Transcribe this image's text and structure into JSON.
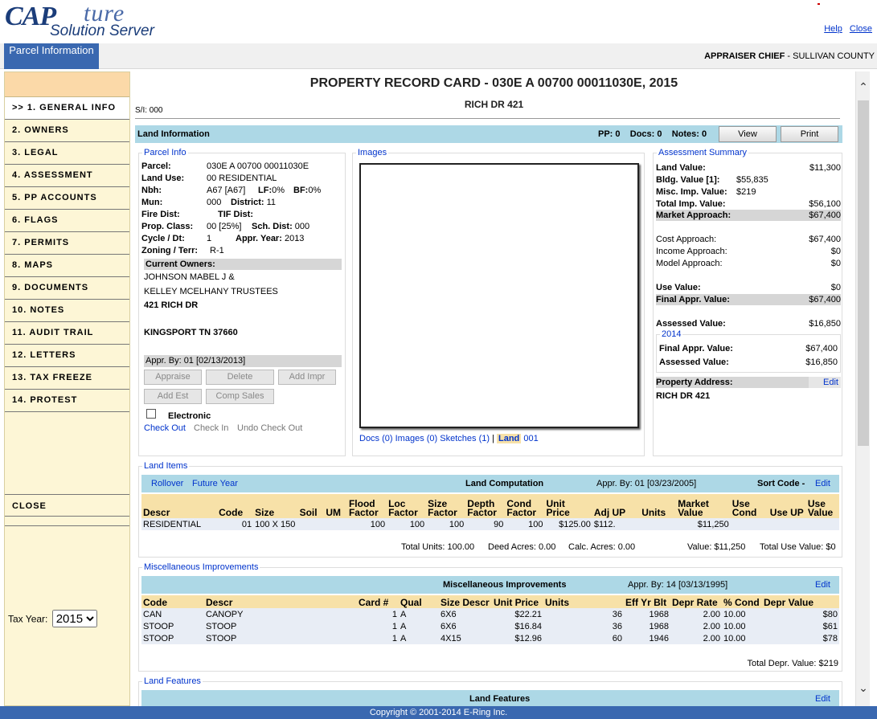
{
  "app": {
    "logo_cap": "CAP",
    "logo_ture": "ture",
    "logo_sub": "Solution Server",
    "help": "Help",
    "close": "Close",
    "tab_label": "Parcel Information",
    "user_role": "APPRAISER CHIEF",
    "user_sep": " - ",
    "user_county": "SULLIVAN COUNTY"
  },
  "sidebar": {
    "items": [
      ">> 1. GENERAL INFO",
      "2. OWNERS",
      "3. LEGAL",
      "4. ASSESSMENT",
      "5. PP ACCOUNTS",
      "6. FLAGS",
      "7. PERMITS",
      "8. MAPS",
      "9. DOCUMENTS",
      "10. NOTES",
      "11. AUDIT TRAIL",
      "12. LETTERS",
      "13. TAX FREEZE",
      "14. PROTEST"
    ],
    "close_label": "CLOSE",
    "tax_year_label": "Tax Year:",
    "tax_year_value": "2015"
  },
  "card": {
    "title": "PROPERTY RECORD CARD - 030E A 00700 00011030E, 2015",
    "address": "RICH DR 421",
    "si": "S/I: 000"
  },
  "land_info_bar": {
    "label": "Land Information",
    "pp": "PP: 0",
    "docs": "Docs: 0",
    "notes": "Notes: 0",
    "view_button": "View",
    "print_button": "Print"
  },
  "parcel_info": {
    "legend": "Parcel Info",
    "parcel_label": "Parcel:",
    "parcel_value": "030E A 00700 00011030E",
    "land_use_label": "Land Use:",
    "land_use_value": "00 RESIDENTIAL",
    "nbh_label": "Nbh:",
    "nbh_value": "A67  [A67]",
    "lf_label": "LF:",
    "lf_value": "0%",
    "bf_label": "BF:",
    "bf_value": "0%",
    "mun_label": "Mun:",
    "mun_value": "000",
    "district_label": "District:",
    "district_value": "11",
    "fire_label": "Fire Dist:",
    "tif_label": "TIF Dist:",
    "prop_class_label": "Prop. Class:",
    "prop_class_value": "00  [25%]",
    "sch_label": "Sch. Dist:",
    "sch_value": "000",
    "cycle_label": "Cycle / Dt:",
    "cycle_value": "1",
    "appr_year_label": "Appr. Year:",
    "appr_year_value": "2013",
    "zoning_label": "Zoning / Terr:",
    "zoning_value": "R-1",
    "owners_header": "Current Owners:",
    "owner1": "JOHNSON MABEL J &",
    "owner2": "KELLEY MCELHANY TRUSTEES",
    "owner_addr1": "421 RICH DR",
    "owner_addr2": "KINGSPORT TN 37660",
    "appr_by": "Appr. By: 01 [02/13/2013]",
    "btn_appraise": "Appraise",
    "btn_delete": "Delete",
    "btn_add_impr": "Add Impr",
    "btn_add_est": "Add Est",
    "btn_comp_sales": "Comp Sales",
    "electronic_label": "Electronic",
    "check_out": "Check Out",
    "check_in": "Check In",
    "undo_check_out": "Undo Check Out"
  },
  "images": {
    "legend": "Images",
    "docs_link": "Docs (0)",
    "images_link": "Images (0)",
    "sketches_link": "Sketches (1)",
    "sep": "|",
    "land_link": "Land",
    "land_num": "001"
  },
  "assessment": {
    "legend": "Assessment Summary",
    "land_value_label": "Land Value:",
    "land_value": "$11,300",
    "bldg_value_label": "Bldg. Value  [1]:",
    "bldg_value": "$55,835",
    "misc_imp_label": "Misc. Imp. Value:",
    "misc_imp_value": "$219",
    "total_imp_label": "Total Imp. Value:",
    "total_imp_value": "$56,100",
    "market_label": "Market Approach:",
    "market_value": "$67,400",
    "cost_label": "Cost Approach:",
    "cost_value": "$67,400",
    "income_label": "Income Approach:",
    "income_value": "$0",
    "model_label": "Model Approach:",
    "model_value": "$0",
    "use_label": "Use Value:",
    "use_value": "$0",
    "final_label": "Final Appr. Value:",
    "final_value": "$67,400",
    "assessed_label": "Assessed Value:",
    "assessed_value": "$16,850",
    "prior_year": "2014",
    "prior_final_label": "Final Appr. Value:",
    "prior_final_value": "$67,400",
    "prior_assessed_label": "Assessed Value:",
    "prior_assessed_value": "$16,850",
    "prop_addr_label": "Property Address:",
    "edit": "Edit",
    "prop_addr_value": "RICH DR 421"
  },
  "land_items": {
    "legend": "Land Items",
    "rollover": "Rollover",
    "future_year": "Future Year",
    "computation": "Land Computation",
    "appr_by": "Appr. By: 01 [03/23/2005]",
    "sort_code": "Sort Code -",
    "edit": "Edit",
    "headers": [
      "Descr",
      "Code",
      "Size",
      "Soil",
      "UM",
      "Flood Factor",
      "Loc Factor",
      "Size Factor",
      "Depth Factor",
      "Cond Factor",
      "Unit Price",
      "Adj UP",
      "Units",
      "Market Value",
      "Use Cond",
      "Use UP",
      "Use Value"
    ],
    "rows": [
      [
        "RESIDENTIAL",
        "01",
        "100 X 150",
        "",
        "",
        "100",
        "100",
        "100",
        "90",
        "100",
        "$125.00",
        "$112.",
        "",
        "$11,250",
        "",
        "",
        ""
      ]
    ],
    "total_units": "Total Units: 100.00",
    "deed_acres": "Deed Acres: 0.00",
    "calc_acres": "Calc. Acres: 0.00",
    "value": "Value: $11,250",
    "total_use_value": "Total Use Value: $0"
  },
  "misc_improvements": {
    "legend": "Miscellaneous Improvements",
    "title": "Miscellaneous Improvements",
    "appr_by": "Appr. By: 14 [03/13/1995]",
    "edit": "Edit",
    "headers": [
      "Code",
      "Descr",
      "Card #",
      "Qual",
      "Size Descr",
      "Unit Price",
      "Units",
      "Eff Yr Blt",
      "Depr Rate",
      "% Cond",
      "Depr Value"
    ],
    "rows": [
      [
        "CAN",
        "CANOPY",
        "1",
        "A",
        "6X6",
        "$22.21",
        "36",
        "1968",
        "2.00",
        "10.00",
        "$80"
      ],
      [
        "STOOP",
        "STOOP",
        "1",
        "A",
        "6X6",
        "$16.84",
        "36",
        "1968",
        "2.00",
        "10.00",
        "$61"
      ],
      [
        "STOOP",
        "STOOP",
        "1",
        "A",
        "4X15",
        "$12.96",
        "60",
        "1946",
        "2.00",
        "10.00",
        "$78"
      ]
    ],
    "total": "Total Depr. Value: $219"
  },
  "land_features": {
    "legend": "Land Features",
    "title": "Land Features",
    "edit": "Edit"
  },
  "footer": "Copyright © 2001-2014 E-Ring Inc."
}
